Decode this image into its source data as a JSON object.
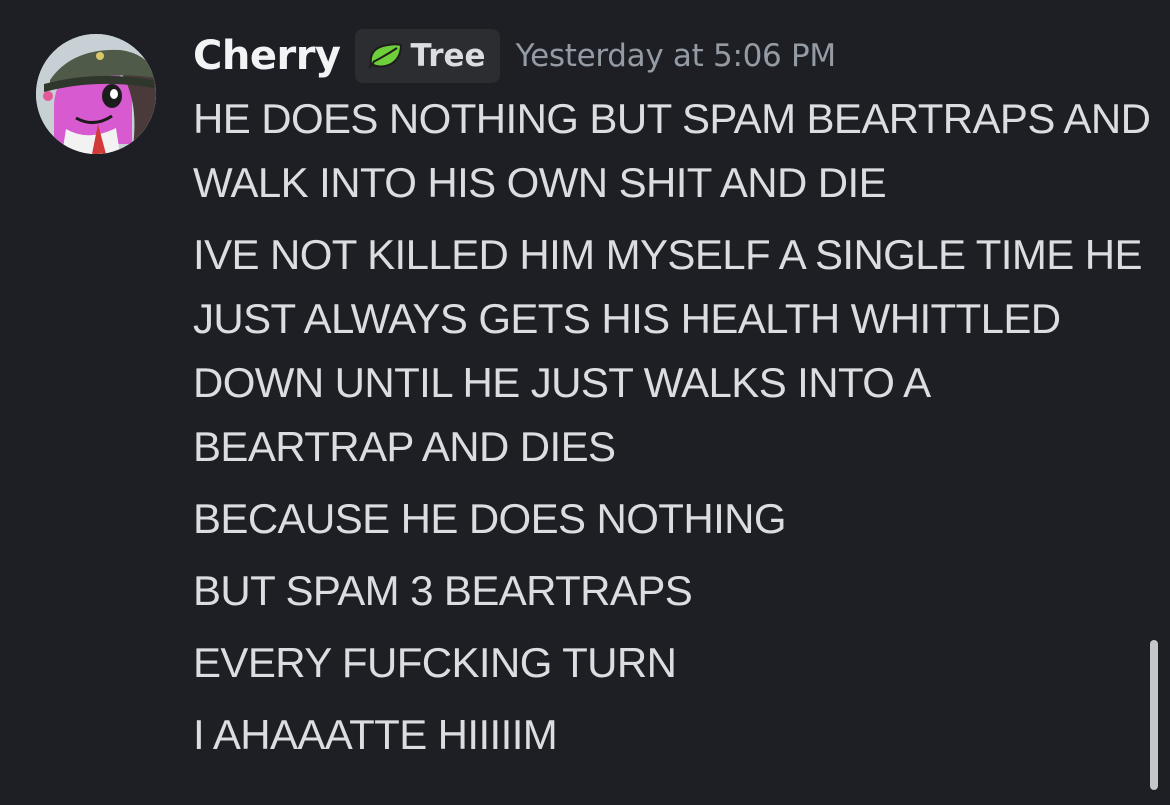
{
  "message": {
    "author": {
      "username": "Cherry",
      "role_icon": "leaf-icon",
      "role_name": "Tree",
      "avatar": "avatar-image"
    },
    "timestamp": "Yesterday at 5:06 PM",
    "lines": [
      "HE DOES NOTHING BUT SPAM BEARTRAPS AND WALK INTO HIS OWN SHIT AND DIE",
      "IVE NOT KILLED HIM MYSELF A SINGLE TIME HE JUST ALWAYS GETS HIS HEALTH WHITTLED DOWN UNTIL HE JUST WALKS INTO A BEARTRAP AND DIES",
      "BECAUSE HE DOES NOTHING",
      "BUT SPAM 3 BEARTRAPS",
      "EVERY FUFCKING TURN",
      "I AHAAATTE HIIIIIM"
    ]
  },
  "colors": {
    "background": "#1e1f24",
    "text": "#dbdee1",
    "timestamp": "#949ba4",
    "role_tag_bg": "#2b2d31",
    "leaf_green": "#6fcf3a"
  }
}
